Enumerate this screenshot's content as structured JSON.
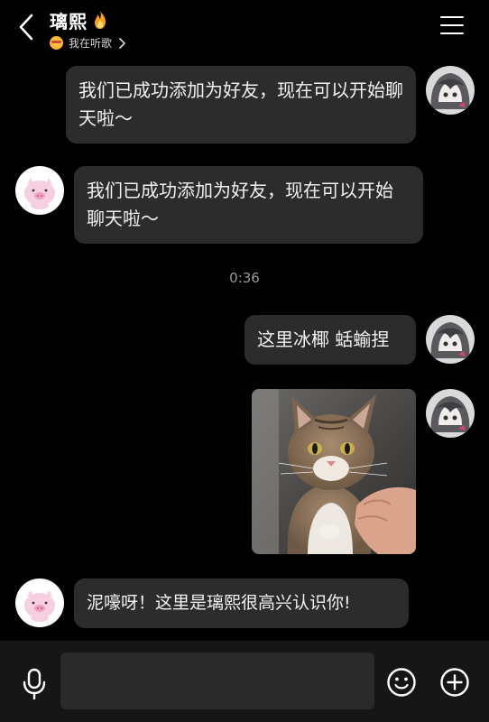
{
  "header": {
    "title": "璃熙",
    "title_badge_icon": "fire-icon",
    "status_icon": "music-face-emoji-icon",
    "status_text": "我在听歌"
  },
  "messages": [
    {
      "side": "right",
      "type": "text",
      "avatar": "anime-girl-avatar",
      "text": "我们已成功添加为好友，现在可以开始聊天啦～"
    },
    {
      "side": "left",
      "type": "text",
      "avatar": "pink-pig-avatar",
      "text": "我们已成功添加为好友，现在可以开始聊天啦～"
    },
    {
      "type": "timestamp",
      "text": "0:36"
    },
    {
      "side": "right",
      "type": "text",
      "avatar": "anime-girl-avatar",
      "text": "这里冰椰 蛞蝓捏"
    },
    {
      "side": "right",
      "type": "image",
      "avatar": "anime-girl-avatar",
      "image": "cat-photo"
    },
    {
      "side": "left",
      "type": "text",
      "avatar": "pink-pig-avatar",
      "text": "泥嚎呀！这里是璃熙很高兴认识你!"
    }
  ],
  "composer": {
    "input_value": "",
    "input_placeholder": "",
    "icons": [
      "microphone-icon",
      "emoji-icon",
      "plus-icon"
    ]
  },
  "colors": {
    "background": "#000000",
    "bubble": "#2c2c2c",
    "composer_bar": "#161616",
    "input": "#2a2a2a",
    "timestamp_text": "#9a9a9a"
  }
}
